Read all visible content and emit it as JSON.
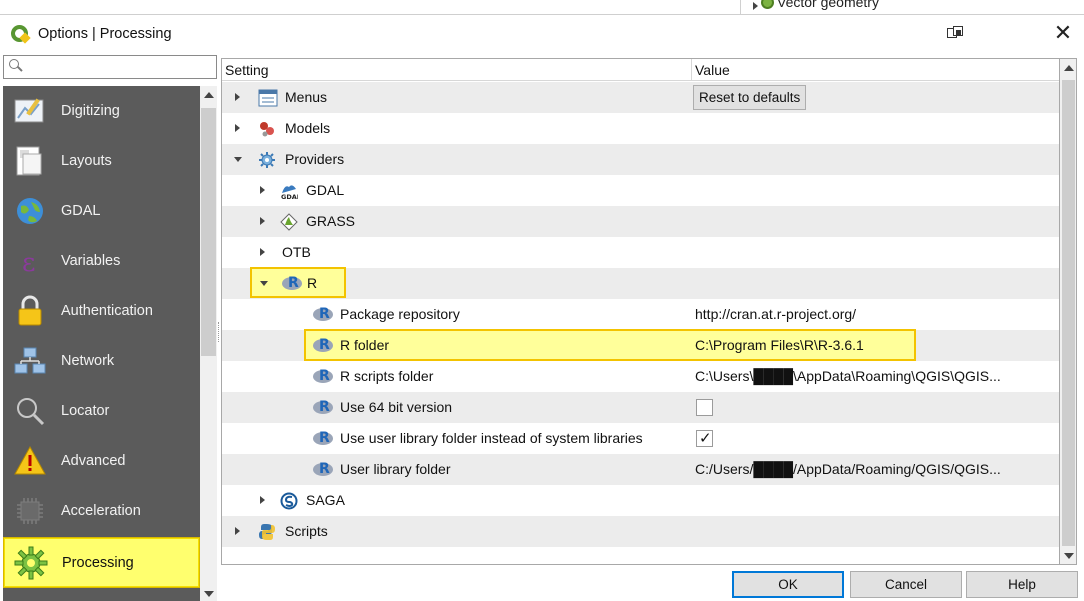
{
  "background_window": {
    "item_label": "Vector geometry"
  },
  "window": {
    "title": "Options | Processing"
  },
  "search": {
    "value": "",
    "placeholder": ""
  },
  "sidebar": {
    "items": [
      {
        "label": "Digitizing",
        "icon": "digitizing-icon"
      },
      {
        "label": "Layouts",
        "icon": "layouts-icon"
      },
      {
        "label": "GDAL",
        "icon": "gdal-globe-icon"
      },
      {
        "label": "Variables",
        "icon": "variables-icon"
      },
      {
        "label": "Authentication",
        "icon": "padlock-icon"
      },
      {
        "label": "Network",
        "icon": "network-icon"
      },
      {
        "label": "Locator",
        "icon": "locator-search-icon"
      },
      {
        "label": "Advanced",
        "icon": "warning-icon"
      },
      {
        "label": "Acceleration",
        "icon": "chip-icon"
      },
      {
        "label": "Processing",
        "icon": "processing-gear-icon",
        "selected": true
      }
    ]
  },
  "tree": {
    "columns": {
      "setting": "Setting",
      "value": "Value"
    },
    "rows": [
      {
        "label": "Menus",
        "value_button": "Reset to defaults"
      },
      {
        "label": "Models",
        "value": ""
      },
      {
        "label": "Providers",
        "value": ""
      },
      {
        "label": "GDAL",
        "value": ""
      },
      {
        "label": "GRASS",
        "value": ""
      },
      {
        "label": "OTB",
        "value": ""
      },
      {
        "label": "R",
        "value": ""
      },
      {
        "label": "Package repository",
        "value": "http://cran.at.r-project.org/"
      },
      {
        "label": "R folder",
        "value": "C:\\Program Files\\R\\R-3.6.1"
      },
      {
        "label": "R scripts folder",
        "value": "C:\\Users\\████\\AppData\\Roaming\\QGIS\\QGIS..."
      },
      {
        "label": "Use 64 bit version",
        "checked": false
      },
      {
        "label": "Use user library folder instead of system libraries",
        "checked": true
      },
      {
        "label": "User library folder",
        "value": "C:/Users/████/AppData/Roaming/QGIS/QGIS..."
      },
      {
        "label": "SAGA",
        "value": ""
      },
      {
        "label": "Scripts",
        "value": ""
      }
    ]
  },
  "buttons": {
    "ok": "OK",
    "cancel": "Cancel",
    "help": "Help"
  },
  "colors": {
    "highlight": "#ffff9a",
    "highlight_border": "#f3c300",
    "sidebar_bg": "#5b5b5b",
    "selected_item": "#ffff6e",
    "qgis_green": "#589632",
    "r_blue": "#1f66b8"
  }
}
